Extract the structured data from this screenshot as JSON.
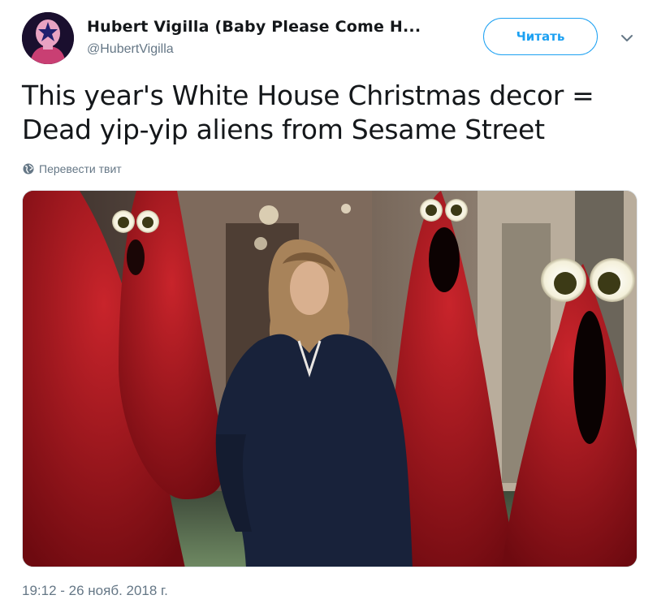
{
  "author": {
    "name": "Hubert Vigilla (Baby Please Come H...",
    "handle": "@HubertVigilla"
  },
  "follow_button": {
    "label": "Читать"
  },
  "tweet": {
    "text_line1": "This year's White House Christmas decor =",
    "text_line2": "Dead yip-yip aliens from Sesame Street",
    "translate_label": "Перевести твит",
    "timestamp": "19:12 - 26 нояб. 2018 г."
  },
  "icons": {
    "translate": "globe-icon",
    "menu": "chevron-down-icon"
  },
  "colors": {
    "accent": "#1da1f2",
    "secondary_text": "#657786",
    "primary_text": "#14171a",
    "tree_red": "#b3141c"
  }
}
